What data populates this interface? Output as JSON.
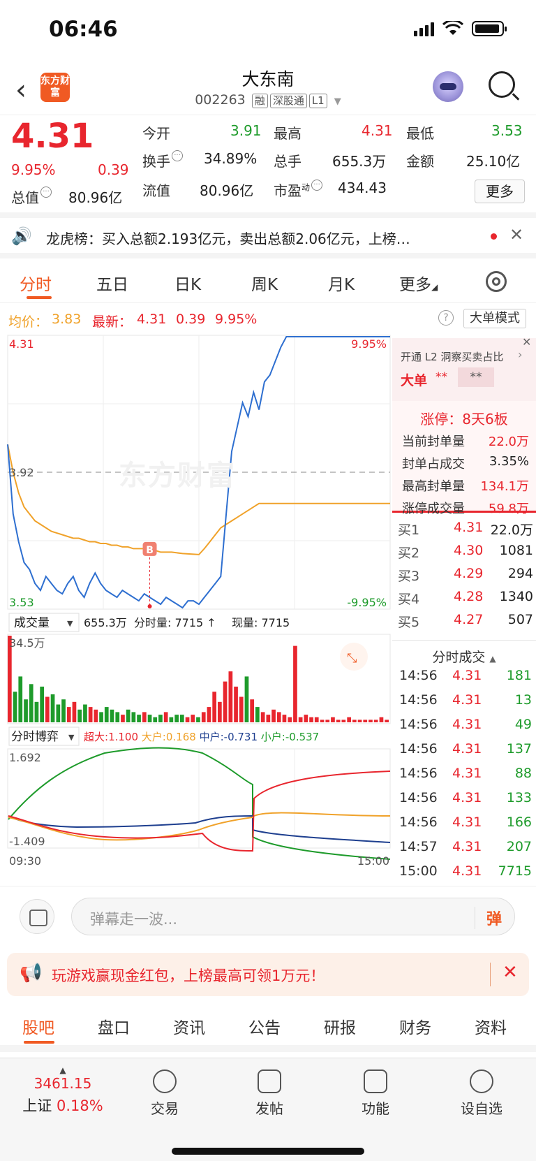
{
  "status_bar": {
    "time": "06:46"
  },
  "header": {
    "logo_text": "东方财富",
    "stock_name": "大东南",
    "stock_code": "002263",
    "tags": [
      "融",
      "深股通",
      "L1"
    ]
  },
  "quote": {
    "price": "4.31",
    "change_pct": "9.95%",
    "change": "0.39",
    "mktcap_label": "总值",
    "mktcap": "80.96亿",
    "open_label": "今开",
    "open": "3.91",
    "high_label": "最高",
    "high": "4.31",
    "low_label": "最低",
    "low": "3.53",
    "turnover_label": "换手",
    "turnover": "34.89%",
    "volume_label": "总手",
    "volume": "655.3万",
    "amount_label": "金额",
    "amount": "25.10亿",
    "float_label": "流值",
    "float": "80.96亿",
    "pe_label": "市盈",
    "pe_sup": "动",
    "pe": "434.43",
    "more_label": "更多"
  },
  "dragon": {
    "text": "龙虎榜：买入总额2.193亿元，卖出总额2.06亿元，上榜…"
  },
  "tabs": [
    "分时",
    "五日",
    "日K",
    "周K",
    "月K",
    "更多"
  ],
  "price_strip": {
    "avg_label": "均价：",
    "avg": "3.83",
    "last_label": "最新：",
    "last": "4.31",
    "chg": "0.39",
    "pct": "9.95%",
    "big_mode": "大单模式"
  },
  "chart_data": {
    "type": "line",
    "x_start": "09:30",
    "x_end": "15:00",
    "y_max_label": "4.31",
    "y_min_label": "3.53",
    "ref_label": "3.92",
    "pct_max_label": "9.95%",
    "pct_min_label": "-9.95%",
    "ylim": [
      3.53,
      4.31
    ],
    "reference": 3.92,
    "buy_marker": "B",
    "price_series": [
      4.0,
      3.8,
      3.72,
      3.66,
      3.64,
      3.6,
      3.58,
      3.62,
      3.6,
      3.58,
      3.57,
      3.6,
      3.62,
      3.58,
      3.56,
      3.6,
      3.63,
      3.6,
      3.58,
      3.57,
      3.56,
      3.58,
      3.57,
      3.56,
      3.55,
      3.57,
      3.56,
      3.55,
      3.54,
      3.56,
      3.55,
      3.54,
      3.53,
      3.55,
      3.55,
      3.54,
      3.56,
      3.58,
      3.6,
      3.62,
      3.8,
      3.98,
      4.05,
      4.12,
      4.08,
      4.15,
      4.1,
      4.18,
      4.2,
      4.24,
      4.28,
      4.31,
      4.31,
      4.31,
      4.31,
      4.31,
      4.31,
      4.31,
      4.31,
      4.31,
      4.31,
      4.31,
      4.31,
      4.31,
      4.31,
      4.31,
      4.31,
      4.31,
      4.31,
      4.31,
      4.31
    ],
    "avg_series": [
      4.0,
      3.92,
      3.86,
      3.82,
      3.8,
      3.78,
      3.77,
      3.76,
      3.75,
      3.745,
      3.74,
      3.735,
      3.73,
      3.73,
      3.725,
      3.72,
      3.72,
      3.715,
      3.715,
      3.71,
      3.71,
      3.705,
      3.705,
      3.7,
      3.7,
      3.7,
      3.695,
      3.695,
      3.69,
      3.69,
      3.69,
      3.688,
      3.686,
      3.685,
      3.684,
      3.683,
      3.7,
      3.72,
      3.74,
      3.76,
      3.77,
      3.78,
      3.79,
      3.8,
      3.81,
      3.82,
      3.83,
      3.83,
      3.83,
      3.83,
      3.83,
      3.83,
      3.83,
      3.83,
      3.83,
      3.83,
      3.83,
      3.83,
      3.83,
      3.83,
      3.83,
      3.83,
      3.83,
      3.83,
      3.83,
      3.83,
      3.83,
      3.83,
      3.83,
      3.83,
      3.83
    ],
    "volume_label": "成交量",
    "volume_info": "655.3万",
    "tick_label": "分时量: 7715",
    "now_label": "现量: 7715",
    "vol_max_label": "34.5万",
    "volume_bars": [
      34,
      12,
      18,
      9,
      15,
      8,
      14,
      10,
      11,
      7,
      9,
      6,
      8,
      5,
      7,
      6,
      5,
      4,
      6,
      5,
      4,
      3,
      5,
      4,
      3,
      4,
      3,
      2,
      3,
      4,
      2,
      3,
      3,
      2,
      3,
      2,
      4,
      6,
      12,
      8,
      16,
      20,
      14,
      10,
      18,
      9,
      6,
      4,
      3,
      5,
      4,
      3,
      2,
      30,
      2,
      3,
      2,
      2,
      1,
      1,
      2,
      1,
      1,
      2,
      1,
      1,
      1,
      1,
      1,
      2,
      1
    ],
    "flow_label": "分时博弈",
    "flow_items": [
      {
        "name": "超大:",
        "value": "1.100",
        "color": "#e8262e"
      },
      {
        "name": "大户:",
        "value": "0.168",
        "color": "#f0a22a"
      },
      {
        "name": "中户:",
        "value": "-0.731",
        "color": "#1e3f8f"
      },
      {
        "name": "小户:",
        "value": "-0.537",
        "color": "#1e9b2b"
      }
    ],
    "flow_max_label": "1.692",
    "flow_min_label": "-1.409"
  },
  "right_panel": {
    "l2_title": "开通 L2 洞察买卖占比",
    "big_label": "大单",
    "big_val": "**",
    "big_val2": "**",
    "limit_title": "涨停：8天6板",
    "rows": [
      {
        "label": "当前封单量",
        "value": "22.0万",
        "color": "#e8262e"
      },
      {
        "label": "封单占成交",
        "value": "3.35%",
        "color": "#222"
      },
      {
        "label": "最高封单量",
        "value": "134.1万",
        "color": "#e8262e"
      },
      {
        "label": "涨停成交量",
        "value": "59.8万",
        "color": "#e8262e"
      }
    ],
    "bids": [
      {
        "label": "买1",
        "price": "4.31",
        "qty": "22.0万"
      },
      {
        "label": "买2",
        "price": "4.30",
        "qty": "1081"
      },
      {
        "label": "买3",
        "price": "4.29",
        "qty": "294"
      },
      {
        "label": "买4",
        "price": "4.28",
        "qty": "1340"
      },
      {
        "label": "买5",
        "price": "4.27",
        "qty": "507"
      }
    ],
    "ticks_title": "分时成交",
    "ticks": [
      {
        "t": "14:56",
        "p": "4.31",
        "v": "181"
      },
      {
        "t": "14:56",
        "p": "4.31",
        "v": "13"
      },
      {
        "t": "14:56",
        "p": "4.31",
        "v": "49"
      },
      {
        "t": "14:56",
        "p": "4.31",
        "v": "137"
      },
      {
        "t": "14:56",
        "p": "4.31",
        "v": "88"
      },
      {
        "t": "14:56",
        "p": "4.31",
        "v": "133"
      },
      {
        "t": "14:56",
        "p": "4.31",
        "v": "166"
      },
      {
        "t": "14:57",
        "p": "4.31",
        "v": "207"
      },
      {
        "t": "15:00",
        "p": "4.31",
        "v": "7715"
      }
    ]
  },
  "comment": {
    "placeholder": "弹幕走一波...",
    "send": "弹"
  },
  "ad": {
    "text": "玩游戏赢现金红包，上榜最高可领1万元！"
  },
  "bottom_tabs": [
    "股吧",
    "盘口",
    "资讯",
    "公告",
    "研报",
    "财务",
    "资料"
  ],
  "toolbar": {
    "index_value": "3461.15",
    "index_name": "上证",
    "index_pct": "0.18%",
    "items": [
      "交易",
      "发帖",
      "功能",
      "设自选"
    ]
  }
}
